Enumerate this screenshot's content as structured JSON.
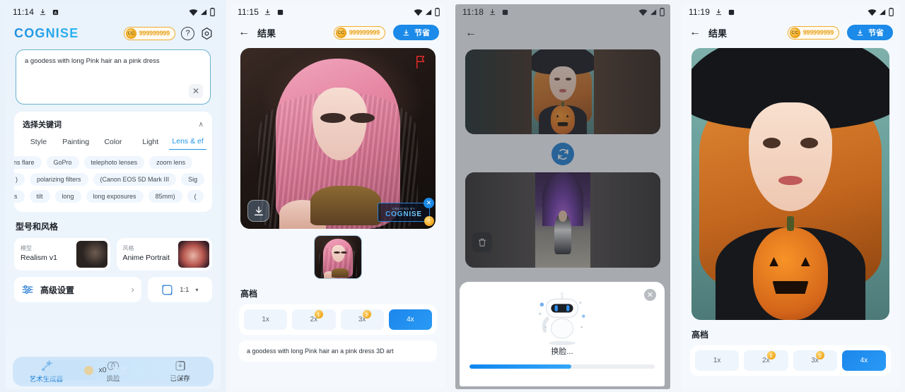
{
  "app": {
    "name": "COGNISE"
  },
  "panel1": {
    "status": {
      "time": "11:14"
    },
    "header": {
      "logo": "COGNISE",
      "coins": "999999999",
      "coin_symbol": "CC",
      "help_label": "?",
      "settings_label": "●"
    },
    "prompt": {
      "value": "a goodess with long Pink hair an a pink  dress",
      "clear_label": "✕"
    },
    "keywords": {
      "title": "选择关键词",
      "collapse_label": "∧",
      "tabs": [
        {
          "label": "Style",
          "active": false
        },
        {
          "label": "Painting",
          "active": false
        },
        {
          "label": "Color",
          "active": false
        },
        {
          "label": "Light",
          "active": false
        },
        {
          "label": "Lens & ef",
          "active": true
        }
      ],
      "rows": [
        [
          "ens flare",
          "GoPro",
          "telephoto lenses",
          "zoom lens"
        ],
        [
          ")",
          "polarizing filters",
          "(Canon EOS 5D Mark III",
          "Sig"
        ],
        [
          "s",
          "tilt",
          "long",
          "long exposures",
          "85mm)",
          "("
        ]
      ]
    },
    "models": {
      "section_title": "型号和风格",
      "model": {
        "label": "模型",
        "value": "Realism v1"
      },
      "style": {
        "label": "风格",
        "value": "Anime Portrait"
      }
    },
    "advanced": {
      "label": "高级设置",
      "arrow": "›",
      "ratio_value": "1:1",
      "ratio_caret": "▾"
    },
    "bottom_nav": {
      "items": [
        {
          "label": "艺术生成器",
          "icon": "magic-wand-icon",
          "active": true
        },
        {
          "label": "换脸",
          "icon": "masks-icon",
          "active": false
        },
        {
          "label": "已保存",
          "icon": "save-icon",
          "active": false
        }
      ],
      "generate": {
        "label": "产生",
        "cost": "x0",
        "arrow": "→"
      }
    }
  },
  "panel2": {
    "status": {
      "time": "11:15"
    },
    "header": {
      "back": "←",
      "title": "结果",
      "coins": "999999999",
      "coin_symbol": "CC",
      "save_label": "节省"
    },
    "image": {
      "alt": "pink haired goddess portrait",
      "flag_icon": "report-flag-icon",
      "download_icon": "download-icon",
      "watermark_top": "CREATED BY",
      "watermark_main": "COGNISE",
      "watermark_close": "✕",
      "watermark_coin": "!"
    },
    "thumbnail": {
      "alt": "pink haired goddess thumbnail"
    },
    "upscale": {
      "section_title": "高档",
      "options": [
        {
          "label": "1x",
          "badge": null,
          "active": false
        },
        {
          "label": "2x",
          "badge": "1",
          "active": false
        },
        {
          "label": "3x",
          "badge": "2",
          "active": false
        },
        {
          "label": "4x",
          "badge": null,
          "active": true
        }
      ]
    },
    "prompt_echo": "a goodess with long Pink hair an a pink  dress 3D art"
  },
  "panel3": {
    "status": {
      "time": "11:18"
    },
    "header": {
      "back": "←"
    },
    "source_card": {
      "alt": "redhead witch with pumpkin"
    },
    "swap_button": {
      "icon": "swap-refresh-icon"
    },
    "target_card": {
      "alt": "woman in purple arch scene",
      "delete_icon": "trash-icon"
    },
    "dialog": {
      "close_label": "✕",
      "robot_icon": "robot-icon",
      "status_text": "换脸...",
      "progress_percent": 55
    }
  },
  "panel4": {
    "status": {
      "time": "11:19"
    },
    "header": {
      "back": "←",
      "title": "结果",
      "coins": "999999999",
      "coin_symbol": "CC",
      "save_label": "节省"
    },
    "image": {
      "alt": "redhead witch holding jack-o-lantern"
    },
    "upscale": {
      "section_title": "高档",
      "options": [
        {
          "label": "1x",
          "badge": null,
          "active": false
        },
        {
          "label": "2x",
          "badge": "1",
          "active": false
        },
        {
          "label": "3x",
          "badge": "2",
          "active": false
        },
        {
          "label": "4x",
          "badge": null,
          "active": true
        }
      ]
    }
  },
  "colors": {
    "accent": "#1b8ae8",
    "coin": "#f0a71c",
    "bg": "#eef4fb",
    "card": "#ffffff"
  }
}
